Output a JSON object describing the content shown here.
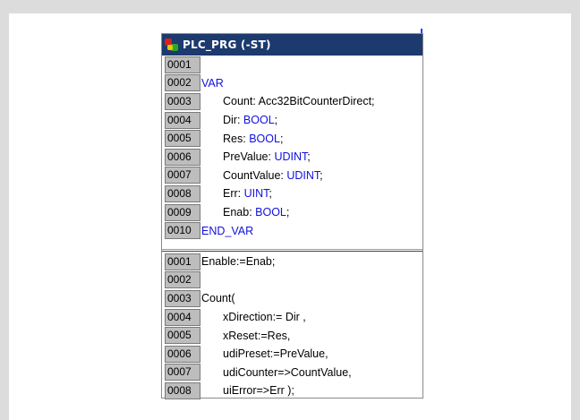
{
  "window": {
    "title": "PLC_PRG (-ST)",
    "title_icon": "pou-icon"
  },
  "declaration": [
    {
      "num": "0001",
      "kw": "",
      "name": "",
      "type": "",
      "end": ""
    },
    {
      "num": "0002",
      "kw": "VAR",
      "name": "",
      "type": "",
      "end": ""
    },
    {
      "num": "0003",
      "kw": "",
      "name": "Count: Acc32BitCounterDirect;",
      "type": "",
      "end": ""
    },
    {
      "num": "0004",
      "kw": "",
      "name": "Dir: ",
      "type": "BOOL",
      "end": ";"
    },
    {
      "num": "0005",
      "kw": "",
      "name": "Res: ",
      "type": "BOOL",
      "end": ";"
    },
    {
      "num": "0006",
      "kw": "",
      "name": "PreValue: ",
      "type": "UDINT",
      "end": ";"
    },
    {
      "num": "0007",
      "kw": "",
      "name": "CountValue: ",
      "type": "UDINT",
      "end": ";"
    },
    {
      "num": "0008",
      "kw": "",
      "name": "Err: ",
      "type": "UINT",
      "end": ";"
    },
    {
      "num": "0009",
      "kw": "",
      "name": "Enab: ",
      "type": "BOOL",
      "end": ";"
    },
    {
      "num": "0010",
      "kw": "END_VAR",
      "name": "",
      "type": "",
      "end": ""
    }
  ],
  "body": [
    {
      "num": "0001",
      "text": "Enable:=Enab;",
      "indent": false
    },
    {
      "num": "0002",
      "text": "",
      "indent": false
    },
    {
      "num": "0003",
      "text": "Count(",
      "indent": false
    },
    {
      "num": "0004",
      "text": "xDirection:= Dir ,",
      "indent": true
    },
    {
      "num": "0005",
      "text": "xReset:=Res,",
      "indent": true
    },
    {
      "num": "0006",
      "text": "udiPreset:=PreValue,",
      "indent": true
    },
    {
      "num": "0007",
      "text": "udiCounter=>CountValue,",
      "indent": true
    },
    {
      "num": "0008",
      "text": "uiError=>Err );",
      "indent": true
    }
  ],
  "colors": {
    "titlebar": "#1c3a6e",
    "keyword": "#1010e0",
    "line_number_bg": "#bdbdbd"
  }
}
